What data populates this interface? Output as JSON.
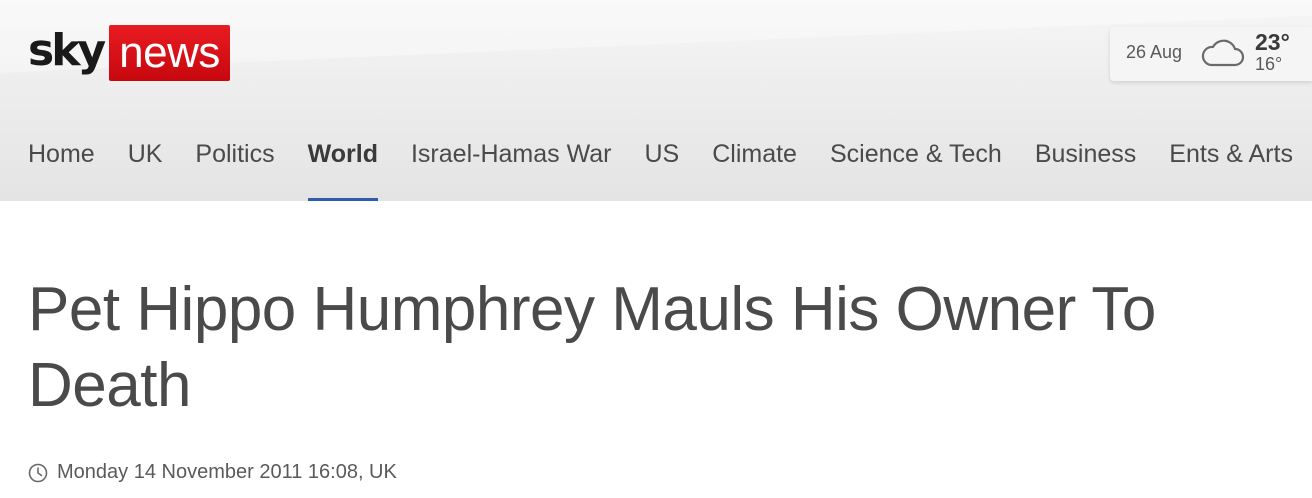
{
  "brand": {
    "sky": "sky",
    "news": "news"
  },
  "weather": {
    "date": "26 Aug",
    "high": "23°",
    "low": "16°",
    "icon": "cloud-icon"
  },
  "nav": {
    "items": [
      {
        "label": "Home",
        "active": false
      },
      {
        "label": "UK",
        "active": false
      },
      {
        "label": "Politics",
        "active": false
      },
      {
        "label": "World",
        "active": true
      },
      {
        "label": "Israel-Hamas War",
        "active": false
      },
      {
        "label": "US",
        "active": false
      },
      {
        "label": "Climate",
        "active": false
      },
      {
        "label": "Science & Tech",
        "active": false
      },
      {
        "label": "Business",
        "active": false
      },
      {
        "label": "Ents & Arts",
        "active": false
      }
    ]
  },
  "article": {
    "headline": "Pet Hippo Humphrey Mauls His Owner To Death",
    "timestamp": "Monday 14 November 2011 16:08, UK"
  },
  "colors": {
    "brand_red": "#e10a0a",
    "nav_active_underline": "#2f5ea8",
    "text": "#4a4a4a"
  }
}
